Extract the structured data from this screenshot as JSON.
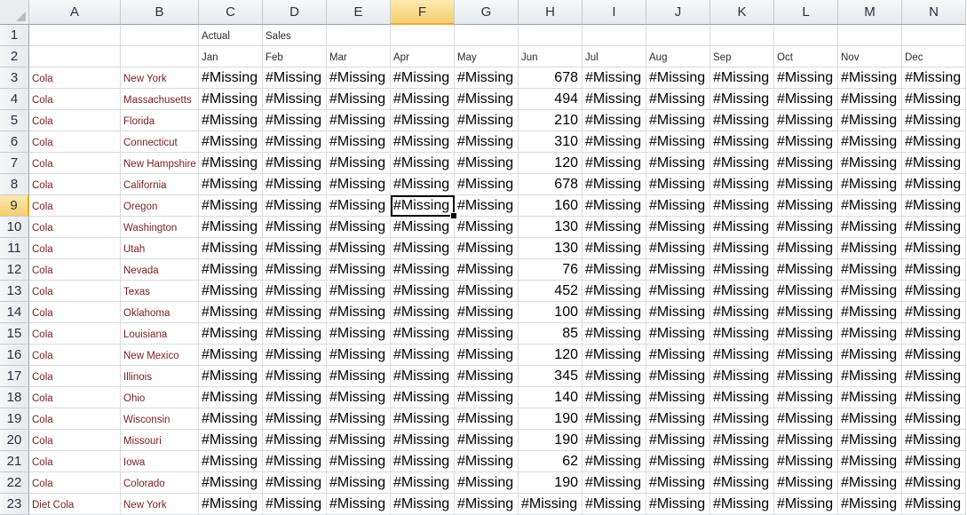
{
  "columns": [
    "A",
    "B",
    "C",
    "D",
    "E",
    "F",
    "G",
    "H",
    "I",
    "J",
    "K",
    "L",
    "M",
    "N"
  ],
  "active_column": "F",
  "active_row": "9",
  "header_rows": [
    {
      "row": "1",
      "cells": [
        "",
        "",
        "Actual",
        "Sales",
        "",
        "",
        "",
        "",
        "",
        "",
        "",
        "",
        "",
        ""
      ]
    },
    {
      "row": "2",
      "cells": [
        "",
        "",
        "Jan",
        "Feb",
        "Mar",
        "Apr",
        "May",
        "Jun",
        "Jul",
        "Aug",
        "Sep",
        "Oct",
        "Nov",
        "Dec"
      ]
    }
  ],
  "missing_label": "#Missing",
  "data_rows": [
    {
      "row": "3",
      "product": "Cola",
      "market": "New York",
      "values": [
        "#Missing",
        "#Missing",
        "#Missing",
        "#Missing",
        "#Missing",
        "678",
        "#Missing",
        "#Missing",
        "#Missing",
        "#Missing",
        "#Missing",
        "#Missing"
      ]
    },
    {
      "row": "4",
      "product": "Cola",
      "market": "Massachusetts",
      "values": [
        "#Missing",
        "#Missing",
        "#Missing",
        "#Missing",
        "#Missing",
        "494",
        "#Missing",
        "#Missing",
        "#Missing",
        "#Missing",
        "#Missing",
        "#Missing"
      ]
    },
    {
      "row": "5",
      "product": "Cola",
      "market": "Florida",
      "values": [
        "#Missing",
        "#Missing",
        "#Missing",
        "#Missing",
        "#Missing",
        "210",
        "#Missing",
        "#Missing",
        "#Missing",
        "#Missing",
        "#Missing",
        "#Missing"
      ]
    },
    {
      "row": "6",
      "product": "Cola",
      "market": "Connecticut",
      "values": [
        "#Missing",
        "#Missing",
        "#Missing",
        "#Missing",
        "#Missing",
        "310",
        "#Missing",
        "#Missing",
        "#Missing",
        "#Missing",
        "#Missing",
        "#Missing"
      ]
    },
    {
      "row": "7",
      "product": "Cola",
      "market": "New Hampshire",
      "values": [
        "#Missing",
        "#Missing",
        "#Missing",
        "#Missing",
        "#Missing",
        "120",
        "#Missing",
        "#Missing",
        "#Missing",
        "#Missing",
        "#Missing",
        "#Missing"
      ]
    },
    {
      "row": "8",
      "product": "Cola",
      "market": "California",
      "values": [
        "#Missing",
        "#Missing",
        "#Missing",
        "#Missing",
        "#Missing",
        "678",
        "#Missing",
        "#Missing",
        "#Missing",
        "#Missing",
        "#Missing",
        "#Missing"
      ]
    },
    {
      "row": "9",
      "product": "Cola",
      "market": "Oregon",
      "values": [
        "#Missing",
        "#Missing",
        "#Missing",
        "#Missing",
        "#Missing",
        "160",
        "#Missing",
        "#Missing",
        "#Missing",
        "#Missing",
        "#Missing",
        "#Missing"
      ]
    },
    {
      "row": "10",
      "product": "Cola",
      "market": "Washington",
      "values": [
        "#Missing",
        "#Missing",
        "#Missing",
        "#Missing",
        "#Missing",
        "130",
        "#Missing",
        "#Missing",
        "#Missing",
        "#Missing",
        "#Missing",
        "#Missing"
      ]
    },
    {
      "row": "11",
      "product": "Cola",
      "market": "Utah",
      "values": [
        "#Missing",
        "#Missing",
        "#Missing",
        "#Missing",
        "#Missing",
        "130",
        "#Missing",
        "#Missing",
        "#Missing",
        "#Missing",
        "#Missing",
        "#Missing"
      ]
    },
    {
      "row": "12",
      "product": "Cola",
      "market": "Nevada",
      "values": [
        "#Missing",
        "#Missing",
        "#Missing",
        "#Missing",
        "#Missing",
        "76",
        "#Missing",
        "#Missing",
        "#Missing",
        "#Missing",
        "#Missing",
        "#Missing"
      ]
    },
    {
      "row": "13",
      "product": "Cola",
      "market": "Texas",
      "values": [
        "#Missing",
        "#Missing",
        "#Missing",
        "#Missing",
        "#Missing",
        "452",
        "#Missing",
        "#Missing",
        "#Missing",
        "#Missing",
        "#Missing",
        "#Missing"
      ]
    },
    {
      "row": "14",
      "product": "Cola",
      "market": "Oklahoma",
      "values": [
        "#Missing",
        "#Missing",
        "#Missing",
        "#Missing",
        "#Missing",
        "100",
        "#Missing",
        "#Missing",
        "#Missing",
        "#Missing",
        "#Missing",
        "#Missing"
      ]
    },
    {
      "row": "15",
      "product": "Cola",
      "market": "Louisiana",
      "values": [
        "#Missing",
        "#Missing",
        "#Missing",
        "#Missing",
        "#Missing",
        "85",
        "#Missing",
        "#Missing",
        "#Missing",
        "#Missing",
        "#Missing",
        "#Missing"
      ]
    },
    {
      "row": "16",
      "product": "Cola",
      "market": "New Mexico",
      "values": [
        "#Missing",
        "#Missing",
        "#Missing",
        "#Missing",
        "#Missing",
        "120",
        "#Missing",
        "#Missing",
        "#Missing",
        "#Missing",
        "#Missing",
        "#Missing"
      ]
    },
    {
      "row": "17",
      "product": "Cola",
      "market": "Illinois",
      "values": [
        "#Missing",
        "#Missing",
        "#Missing",
        "#Missing",
        "#Missing",
        "345",
        "#Missing",
        "#Missing",
        "#Missing",
        "#Missing",
        "#Missing",
        "#Missing"
      ]
    },
    {
      "row": "18",
      "product": "Cola",
      "market": "Ohio",
      "values": [
        "#Missing",
        "#Missing",
        "#Missing",
        "#Missing",
        "#Missing",
        "140",
        "#Missing",
        "#Missing",
        "#Missing",
        "#Missing",
        "#Missing",
        "#Missing"
      ]
    },
    {
      "row": "19",
      "product": "Cola",
      "market": "Wisconsin",
      "values": [
        "#Missing",
        "#Missing",
        "#Missing",
        "#Missing",
        "#Missing",
        "190",
        "#Missing",
        "#Missing",
        "#Missing",
        "#Missing",
        "#Missing",
        "#Missing"
      ]
    },
    {
      "row": "20",
      "product": "Cola",
      "market": "Missouri",
      "values": [
        "#Missing",
        "#Missing",
        "#Missing",
        "#Missing",
        "#Missing",
        "190",
        "#Missing",
        "#Missing",
        "#Missing",
        "#Missing",
        "#Missing",
        "#Missing"
      ]
    },
    {
      "row": "21",
      "product": "Cola",
      "market": "Iowa",
      "values": [
        "#Missing",
        "#Missing",
        "#Missing",
        "#Missing",
        "#Missing",
        "62",
        "#Missing",
        "#Missing",
        "#Missing",
        "#Missing",
        "#Missing",
        "#Missing"
      ]
    },
    {
      "row": "22",
      "product": "Cola",
      "market": "Colorado",
      "values": [
        "#Missing",
        "#Missing",
        "#Missing",
        "#Missing",
        "#Missing",
        "190",
        "#Missing",
        "#Missing",
        "#Missing",
        "#Missing",
        "#Missing",
        "#Missing"
      ]
    },
    {
      "row": "23",
      "product": "Diet Cola",
      "market": "New York",
      "values": [
        "#Missing",
        "#Missing",
        "#Missing",
        "#Missing",
        "#Missing",
        "#Missing",
        "#Missing",
        "#Missing",
        "#Missing",
        "#Missing",
        "#Missing",
        "#Missing"
      ]
    }
  ],
  "colors": {
    "market_text": "#7a1e1e",
    "selection_border": "#000000",
    "active_header": "#f6cf6d",
    "gridline": "#dadcdd"
  }
}
